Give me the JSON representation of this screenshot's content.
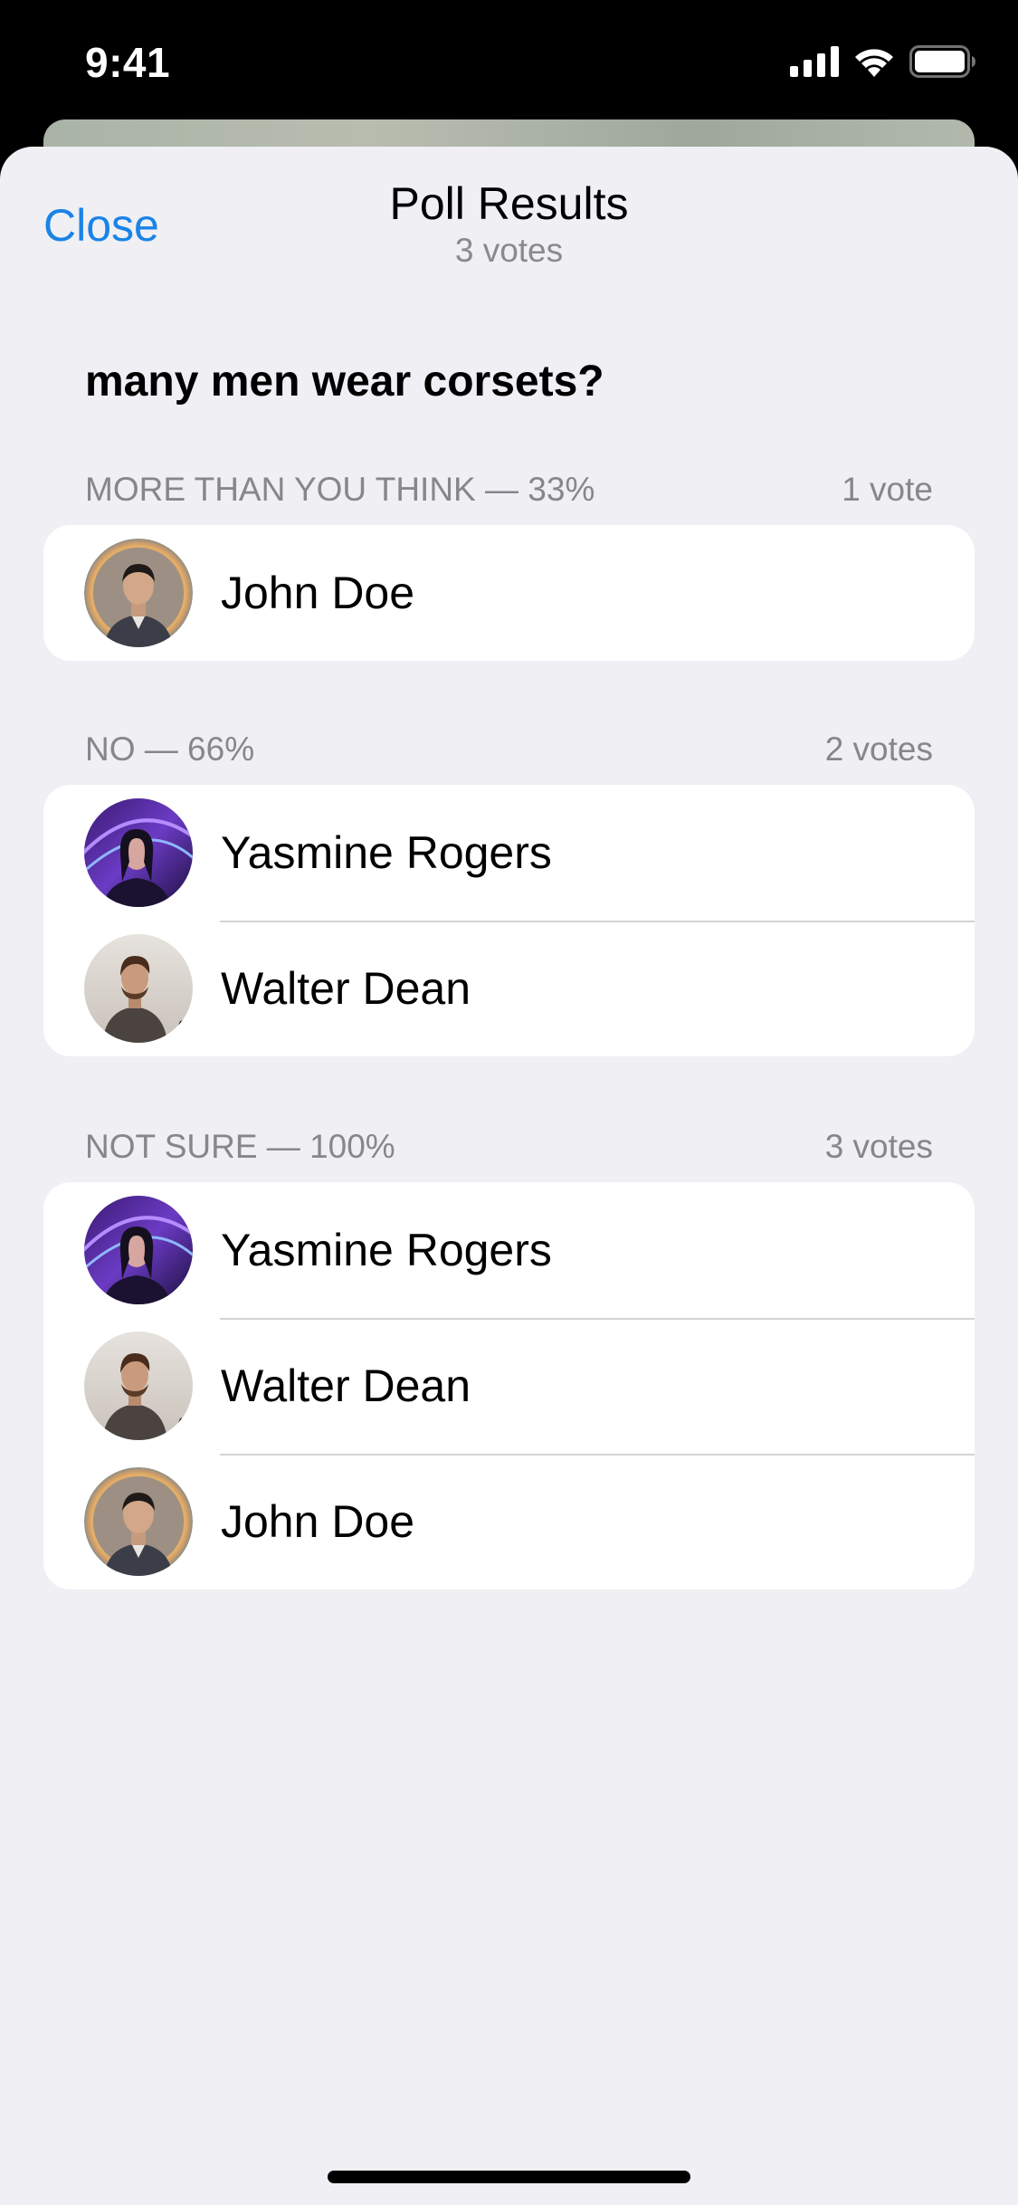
{
  "status_bar": {
    "time": "9:41",
    "icons": [
      "cellular-signal-icon",
      "wifi-icon",
      "battery-icon"
    ]
  },
  "header": {
    "close_label": "Close",
    "title": "Poll Results",
    "subtitle": "3 votes"
  },
  "poll": {
    "question": "many men wear corsets?",
    "options": [
      {
        "label": "MORE THAN YOU THINK — 33%",
        "votes": "1 vote",
        "voters": [
          {
            "name": "John Doe",
            "avatar": "john-doe-avatar"
          }
        ]
      },
      {
        "label": "NO — 66%",
        "votes": "2 votes",
        "voters": [
          {
            "name": "Yasmine Rogers",
            "avatar": "yasmine-rogers-avatar"
          },
          {
            "name": "Walter Dean",
            "avatar": "walter-dean-avatar"
          }
        ]
      },
      {
        "label": "NOT SURE — 100%",
        "votes": "3 votes",
        "voters": [
          {
            "name": "Yasmine Rogers",
            "avatar": "yasmine-rogers-avatar"
          },
          {
            "name": "Walter Dean",
            "avatar": "walter-dean-avatar"
          },
          {
            "name": "John Doe",
            "avatar": "john-doe-avatar"
          }
        ]
      }
    ]
  },
  "colors": {
    "accent": "#1a83e6",
    "sheet_background": "#efeff4",
    "secondary_text": "#86868b",
    "separator": "#d3d3d8"
  }
}
